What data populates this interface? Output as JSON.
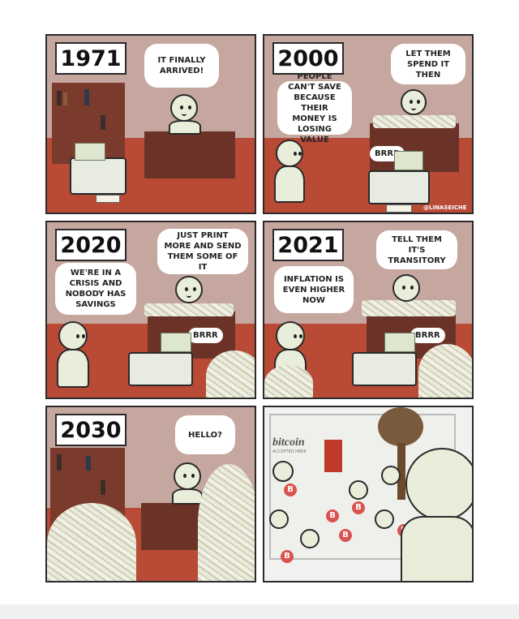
{
  "panels": [
    {
      "year": "1971",
      "bubbles": [
        "IT FINALLY ARRIVED!"
      ]
    },
    {
      "year": "2000",
      "bubbles": [
        "LET THEM SPEND IT THEN",
        "PEOPLE CAN'T SAVE BECAUSE THEIR MONEY IS LOSING VALUE"
      ],
      "sfx": "BRRR",
      "credit": "@LINASEICHE"
    },
    {
      "year": "2020",
      "bubbles": [
        "JUST PRINT MORE AND SEND THEM SOME OF IT",
        "WE'RE IN A CRISIS AND NOBODY HAS SAVINGS"
      ],
      "sfx": "BRRR"
    },
    {
      "year": "2021",
      "bubbles": [
        "TELL THEM IT'S TRANSITORY",
        "INFLATION IS EVEN HIGHER NOW"
      ],
      "sfx": "BRRR"
    },
    {
      "year": "2030",
      "bubbles": [
        "HELLO?"
      ]
    },
    {
      "sign": "bitcoin",
      "sign_sub": "ACCEPTED HERE",
      "badge": "B"
    }
  ],
  "colors": {
    "wall": "#c6a79f",
    "floor": "#b84a36",
    "desk": "#6b3328",
    "figure": "#e9eedb"
  }
}
